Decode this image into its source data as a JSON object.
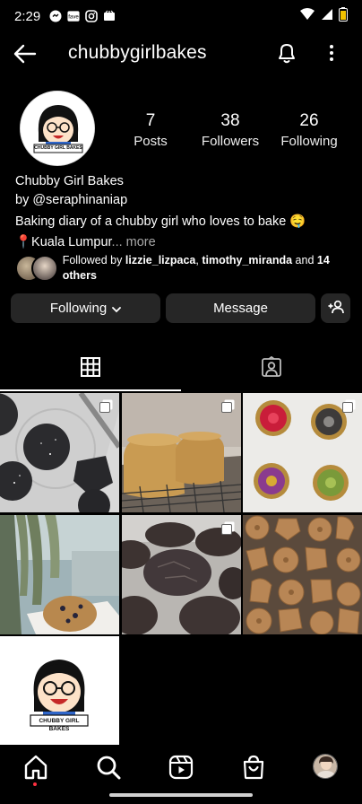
{
  "status_bar": {
    "time": "2:29"
  },
  "header": {
    "username": "chubbygirlbakes"
  },
  "profile": {
    "stats": [
      {
        "value": "7",
        "label": "Posts"
      },
      {
        "value": "38",
        "label": "Followers"
      },
      {
        "value": "26",
        "label": "Following"
      }
    ],
    "display_name": "Chubby Girl Bakes",
    "by_line": "by @seraphinaniap",
    "bio": "Baking diary of a chubby girl who loves to bake 🤤",
    "location": "📍Kuala Lumpur",
    "more_link": "... more",
    "followed_prefix": "Followed by ",
    "followed_user1": "lizzie_lizpaca",
    "followed_sep": ", ",
    "followed_user2": "timothy_miranda",
    "followed_suffix": " and ",
    "followed_others": "14 others",
    "avatar_caption": "CHUBBY GIRL BAKES"
  },
  "actions": {
    "following_label": "Following",
    "message_label": "Message"
  },
  "tabs": [
    "grid-icon",
    "tagged-icon"
  ],
  "grid": {
    "last_post_caption": "CHUBBY GIRL BAKES"
  },
  "bottom_nav": [
    "home-icon",
    "search-icon",
    "reels-icon",
    "shop-icon",
    "profile-avatar"
  ],
  "colors": {
    "background": "#000000",
    "button": "#262626",
    "notification_dot": "#ff3040"
  }
}
